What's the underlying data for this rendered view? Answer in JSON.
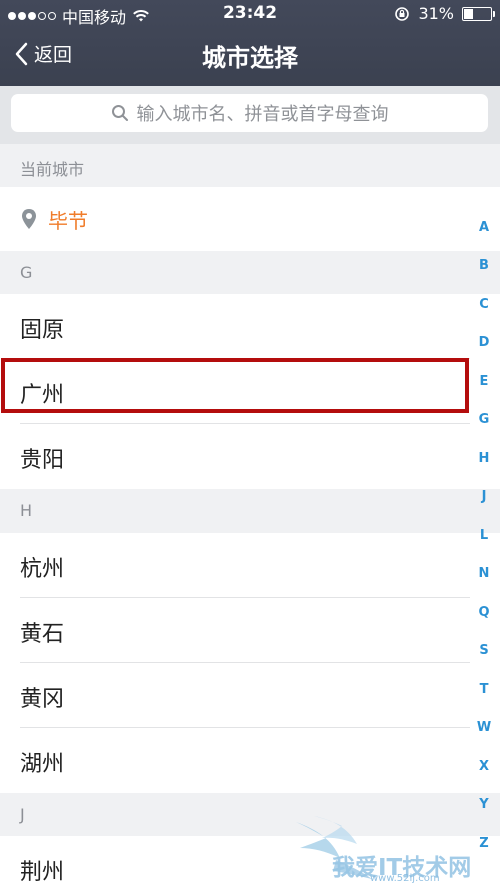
{
  "status": {
    "carrier": "中国移动",
    "time": "23:42",
    "battery_level": "31%",
    "battery_fraction": 0.31
  },
  "nav": {
    "back_label": "返回",
    "title": "城市选择"
  },
  "search": {
    "placeholder": "输入城市名、拼音或首字母查询"
  },
  "current_section": {
    "header": "当前城市",
    "city": "毕节"
  },
  "sections": [
    {
      "letter": "G",
      "cities": [
        "固原",
        "广州",
        "贵阳"
      ]
    },
    {
      "letter": "H",
      "cities": [
        "杭州",
        "黄石",
        "黄冈",
        "湖州"
      ]
    },
    {
      "letter": "J",
      "cities": [
        "荆州"
      ]
    }
  ],
  "index_letters": [
    "A",
    "B",
    "C",
    "D",
    "E",
    "G",
    "H",
    "J",
    "L",
    "N",
    "Q",
    "S",
    "T",
    "W",
    "X",
    "Y",
    "Z"
  ],
  "watermark": {
    "text": "我爱IT技术网",
    "url": "www.52ij.com"
  },
  "colors": {
    "nav_bg": "#3f4555",
    "current_city": "#f07c2a",
    "index": "#2b91d4",
    "highlight": "#b40d0d"
  },
  "icons": {
    "back": "chevron-left-icon",
    "search": "search-icon",
    "location": "location-pin-icon",
    "wifi": "wifi-icon",
    "lock": "rotation-lock-icon",
    "battery": "battery-icon"
  }
}
